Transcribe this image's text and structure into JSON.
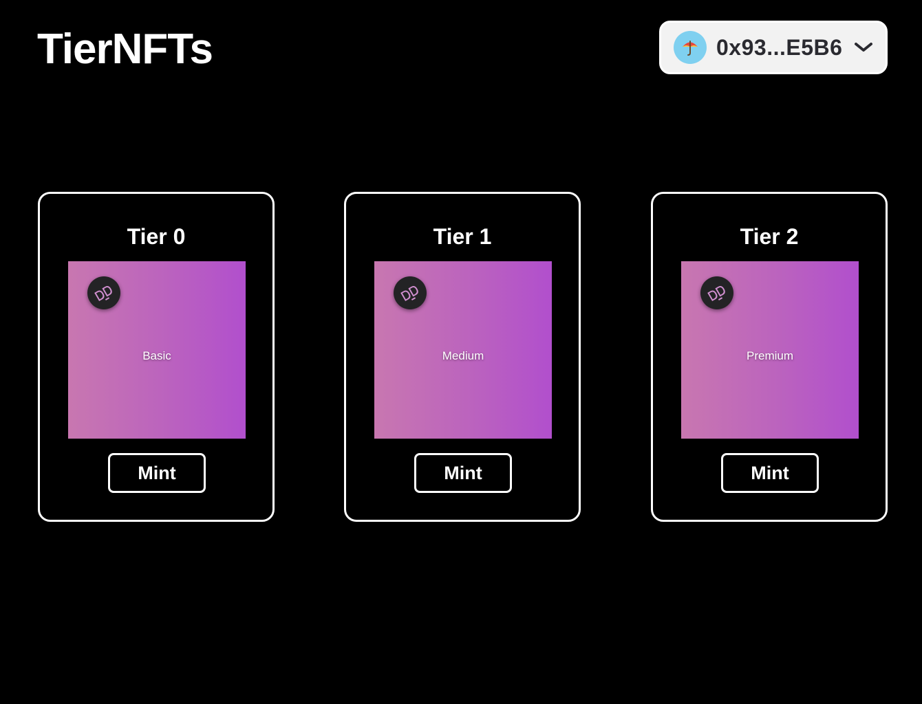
{
  "header": {
    "title": "TierNFTs",
    "wallet": {
      "address": "0x93...E5B6",
      "avatar_icon": "umbrella-emoji-icon",
      "avatar_color": "#7fd0f0",
      "chevron_icon": "chevron-down-icon"
    }
  },
  "tiers": [
    {
      "title": "Tier 0",
      "label": "Basic",
      "mint_label": "Mint",
      "logo_icon": "dd-logo-icon"
    },
    {
      "title": "Tier 1",
      "label": "Medium",
      "mint_label": "Mint",
      "logo_icon": "dd-logo-icon"
    },
    {
      "title": "Tier 2",
      "label": "Premium",
      "mint_label": "Mint",
      "logo_icon": "dd-logo-icon"
    }
  ],
  "colors": {
    "background": "#000000",
    "card_border": "#ffffff",
    "nft_gradient_start": "#c877b0",
    "nft_gradient_end": "#b14fcd",
    "wallet_button_bg": "#f2f2f2"
  }
}
